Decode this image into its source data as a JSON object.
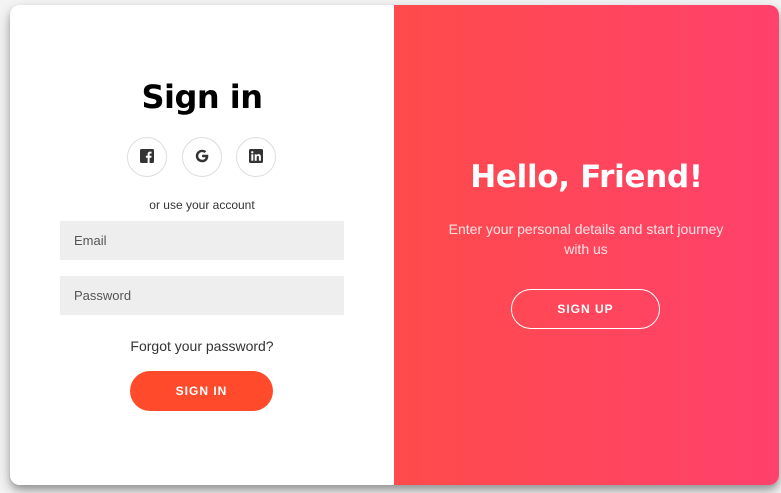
{
  "sign_in": {
    "title": "Sign in",
    "social": [
      {
        "icon": "facebook-icon"
      },
      {
        "icon": "google-icon"
      },
      {
        "icon": "linkedin-icon"
      }
    ],
    "alt_text": "or use your account",
    "email_placeholder": "Email",
    "email_value": "",
    "password_placeholder": "Password",
    "password_value": "",
    "forgot_label": "Forgot your password?",
    "button_label": "SIGN IN"
  },
  "overlay": {
    "title": "Hello, Friend!",
    "subtitle": "Enter your personal details and start journey with us",
    "button_label": "SIGN UP"
  },
  "colors": {
    "accent": "#ff4b2b",
    "gradient_start": "#ff4b4b",
    "gradient_end": "#ff416c",
    "input_bg": "#eeeeee"
  }
}
